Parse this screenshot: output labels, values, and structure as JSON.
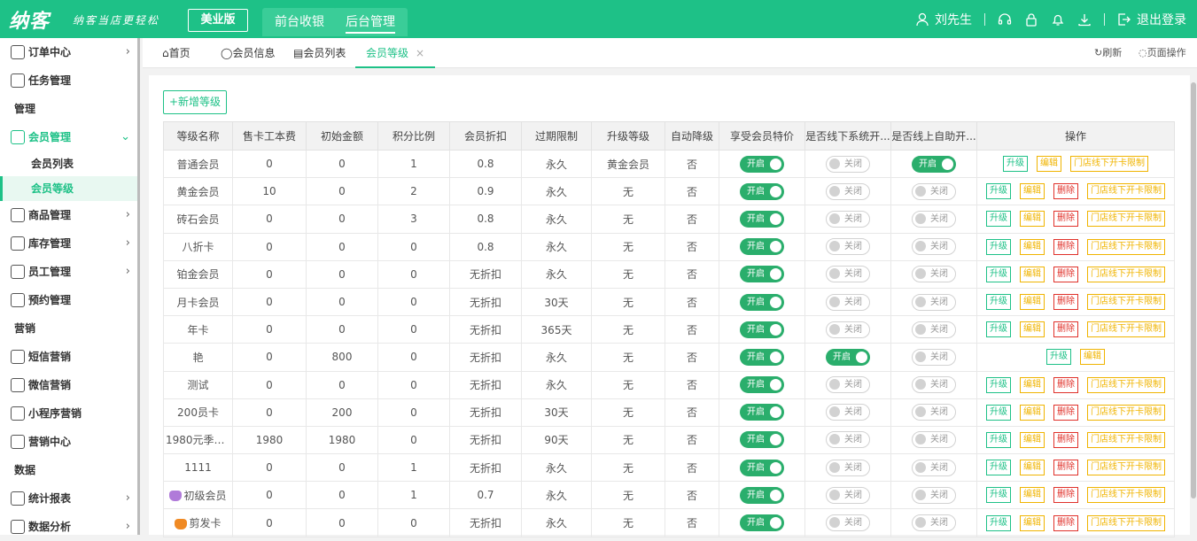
{
  "topbar": {
    "logo": "纳客",
    "slogan": "纳客当店更轻松",
    "edition": "美业版",
    "nav": [
      "前台收银",
      "后台管理"
    ],
    "user": "刘先生",
    "logout": "退出登录"
  },
  "sidebar": {
    "items": [
      {
        "type": "item",
        "label": "订单中心",
        "icon": "globe-icon",
        "arrow": "›"
      },
      {
        "type": "item",
        "label": "任务管理",
        "icon": "task-icon",
        "arrow": ""
      },
      {
        "type": "section",
        "label": "管理"
      },
      {
        "type": "item",
        "label": "会员管理",
        "icon": "crown-icon",
        "arrow": "⌄",
        "open": true
      },
      {
        "type": "sub",
        "label": "会员列表"
      },
      {
        "type": "sub",
        "label": "会员等级",
        "active": true
      },
      {
        "type": "item",
        "label": "商品管理",
        "icon": "goods-icon",
        "arrow": "›"
      },
      {
        "type": "item",
        "label": "库存管理",
        "icon": "warehouse-icon",
        "arrow": "›"
      },
      {
        "type": "item",
        "label": "员工管理",
        "icon": "person-icon",
        "arrow": "›"
      },
      {
        "type": "item",
        "label": "预约管理",
        "icon": "calendar-icon",
        "arrow": ""
      },
      {
        "type": "section",
        "label": "营销"
      },
      {
        "type": "item",
        "label": "短信营销",
        "icon": "mail-icon",
        "arrow": ""
      },
      {
        "type": "item",
        "label": "微信营销",
        "icon": "wechat-icon",
        "arrow": ""
      },
      {
        "type": "item",
        "label": "小程序营销",
        "icon": "miniapp-icon",
        "arrow": ""
      },
      {
        "type": "item",
        "label": "营销中心",
        "icon": "target-icon",
        "arrow": ""
      },
      {
        "type": "section",
        "label": "数据"
      },
      {
        "type": "item",
        "label": "统计报表",
        "icon": "chart-icon",
        "arrow": "›"
      },
      {
        "type": "item",
        "label": "数据分析",
        "icon": "analysis-icon",
        "arrow": "›"
      }
    ]
  },
  "tabs": {
    "home": "首页",
    "member_info": "会员信息",
    "member_list": "会员列表",
    "member_level": "会员等级",
    "close": "×",
    "refresh": "刷新",
    "page_ops": "页面操作"
  },
  "add_button": "+新增等级",
  "table": {
    "headers": [
      "等级名称",
      "售卡工本费",
      "初始金额",
      "积分比例",
      "会员折扣",
      "过期限制",
      "升级等级",
      "自动降级",
      "享受会员特价",
      "是否线下系统开...",
      "是否线上自助开...",
      "操作"
    ],
    "switch_on": "开启",
    "switch_off": "关闭",
    "op_upgrade": "升级",
    "op_edit": "编辑",
    "op_delete": "删除",
    "op_limit": "门店线下开卡限制",
    "rows": [
      {
        "name": "普通会员",
        "fee": "0",
        "init": "0",
        "points": "1",
        "discount": "0.8",
        "expire": "永久",
        "upgrade": "黄金会员",
        "auto": "否",
        "special": true,
        "offline": false,
        "online": true,
        "ops": [
          "up",
          "ed",
          "lim"
        ]
      },
      {
        "name": "黄金会员",
        "fee": "10",
        "init": "0",
        "points": "2",
        "discount": "0.9",
        "expire": "永久",
        "upgrade": "无",
        "auto": "否",
        "special": true,
        "offline": false,
        "online": false,
        "ops": [
          "up",
          "ed",
          "del",
          "lim"
        ]
      },
      {
        "name": "砖石会员",
        "fee": "0",
        "init": "0",
        "points": "3",
        "discount": "0.8",
        "expire": "永久",
        "upgrade": "无",
        "auto": "否",
        "special": true,
        "offline": false,
        "online": false,
        "ops": [
          "up",
          "ed",
          "del",
          "lim"
        ]
      },
      {
        "name": "八折卡",
        "fee": "0",
        "init": "0",
        "points": "0",
        "discount": "0.8",
        "expire": "永久",
        "upgrade": "无",
        "auto": "否",
        "special": true,
        "offline": false,
        "online": false,
        "ops": [
          "up",
          "ed",
          "del",
          "lim"
        ]
      },
      {
        "name": "铂金会员",
        "fee": "0",
        "init": "0",
        "points": "0",
        "discount": "无折扣",
        "expire": "永久",
        "upgrade": "无",
        "auto": "否",
        "special": true,
        "offline": false,
        "online": false,
        "ops": [
          "up",
          "ed",
          "del",
          "lim"
        ]
      },
      {
        "name": "月卡会员",
        "fee": "0",
        "init": "0",
        "points": "0",
        "discount": "无折扣",
        "expire": "30天",
        "upgrade": "无",
        "auto": "否",
        "special": true,
        "offline": false,
        "online": false,
        "ops": [
          "up",
          "ed",
          "del",
          "lim"
        ]
      },
      {
        "name": "年卡",
        "fee": "0",
        "init": "0",
        "points": "0",
        "discount": "无折扣",
        "expire": "365天",
        "upgrade": "无",
        "auto": "否",
        "special": true,
        "offline": false,
        "online": false,
        "ops": [
          "up",
          "ed",
          "del",
          "lim"
        ]
      },
      {
        "name": "艳",
        "fee": "0",
        "init": "800",
        "points": "0",
        "discount": "无折扣",
        "expire": "永久",
        "upgrade": "无",
        "auto": "否",
        "special": true,
        "offline": true,
        "online": false,
        "ops": [
          "up",
          "ed"
        ]
      },
      {
        "name": "测试",
        "fee": "0",
        "init": "0",
        "points": "0",
        "discount": "无折扣",
        "expire": "永久",
        "upgrade": "无",
        "auto": "否",
        "special": true,
        "offline": false,
        "online": false,
        "ops": [
          "up",
          "ed",
          "del",
          "lim"
        ]
      },
      {
        "name": "200员卡",
        "fee": "0",
        "init": "200",
        "points": "0",
        "discount": "无折扣",
        "expire": "30天",
        "upgrade": "无",
        "auto": "否",
        "special": true,
        "offline": false,
        "online": false,
        "ops": [
          "up",
          "ed",
          "del",
          "lim"
        ]
      },
      {
        "name": "1980元季度...",
        "fee": "1980",
        "init": "1980",
        "points": "0",
        "discount": "无折扣",
        "expire": "90天",
        "upgrade": "无",
        "auto": "否",
        "special": true,
        "offline": false,
        "online": false,
        "ops": [
          "up",
          "ed",
          "del",
          "lim"
        ]
      },
      {
        "name": "1111",
        "fee": "0",
        "init": "0",
        "points": "1",
        "discount": "无折扣",
        "expire": "永久",
        "upgrade": "无",
        "auto": "否",
        "special": true,
        "offline": false,
        "online": false,
        "ops": [
          "up",
          "ed",
          "del",
          "lim"
        ]
      },
      {
        "name": "初级会员",
        "fee": "0",
        "init": "0",
        "points": "1",
        "discount": "0.7",
        "expire": "永久",
        "upgrade": "无",
        "auto": "否",
        "special": true,
        "offline": false,
        "online": false,
        "ops": [
          "up",
          "ed",
          "del",
          "lim"
        ],
        "badge": "#b07ad9"
      },
      {
        "name": "剪发卡",
        "fee": "0",
        "init": "0",
        "points": "0",
        "discount": "无折扣",
        "expire": "永久",
        "upgrade": "无",
        "auto": "否",
        "special": true,
        "offline": false,
        "online": false,
        "ops": [
          "up",
          "ed",
          "del",
          "lim"
        ],
        "badge": "#f08a24"
      }
    ]
  },
  "colors": {
    "brand": "#1ec187",
    "switch_on": "#2aae6c",
    "edit": "#f0b400",
    "delete": "#e0312a"
  }
}
